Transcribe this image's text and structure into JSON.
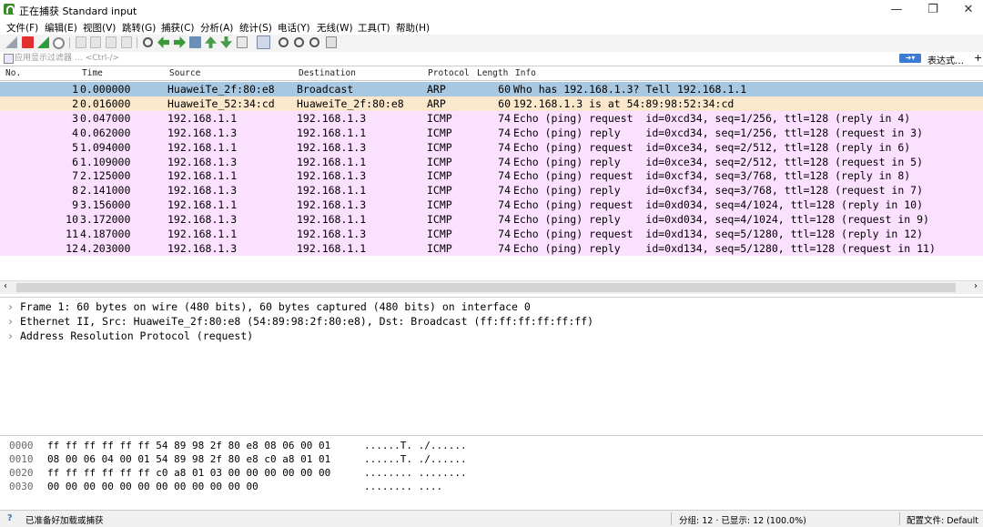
{
  "window": {
    "title": "正在捕获 Standard input",
    "minimize": "—",
    "maximize": "❐",
    "close": "✕"
  },
  "menu": [
    "文件(F)",
    "编辑(E)",
    "视图(V)",
    "跳转(G)",
    "捕获(C)",
    "分析(A)",
    "统计(S)",
    "电话(Y)",
    "无线(W)",
    "工具(T)",
    "帮助(H)"
  ],
  "toolbar_icons": [
    "shark-fin-start-icon",
    "stop-capture-icon",
    "restart-capture-icon",
    "capture-options-icon",
    "open-file-icon",
    "save-file-icon",
    "close-file-icon",
    "reload-file-icon",
    "find-packet-icon",
    "go-back-icon",
    "go-forward-icon",
    "go-to-packet-icon",
    "go-first-icon",
    "go-last-icon",
    "auto-scroll-icon",
    "colorize-icon",
    "zoom-in-icon",
    "zoom-out-icon",
    "zoom-normal-icon",
    "resize-columns-icon"
  ],
  "filter": {
    "placeholder": "应用显示过滤器 … <Ctrl-/>",
    "expression_label": "表达式…",
    "add_label": "+"
  },
  "columns": {
    "no": "No.",
    "time": "Time",
    "source": "Source",
    "destination": "Destination",
    "protocol": "Protocol",
    "length": "Length",
    "info": "Info"
  },
  "packets": [
    {
      "no": "1",
      "time": "0.000000",
      "source": "HuaweiTe_2f:80:e8",
      "destination": "Broadcast",
      "protocol": "ARP",
      "length": "60",
      "info": "Who has 192.168.1.3? Tell 192.168.1.1",
      "bg": "#a8c8e2"
    },
    {
      "no": "2",
      "time": "0.016000",
      "source": "HuaweiTe_52:34:cd",
      "destination": "HuaweiTe_2f:80:e8",
      "protocol": "ARP",
      "length": "60",
      "info": "192.168.1.3 is at 54:89:98:52:34:cd",
      "bg": "#fbe8cc"
    },
    {
      "no": "3",
      "time": "0.047000",
      "source": "192.168.1.1",
      "destination": "192.168.1.3",
      "protocol": "ICMP",
      "length": "74",
      "info": "Echo (ping) request  id=0xcd34, seq=1/256, ttl=128 (reply in 4)",
      "bg": "#fce0ff"
    },
    {
      "no": "4",
      "time": "0.062000",
      "source": "192.168.1.3",
      "destination": "192.168.1.1",
      "protocol": "ICMP",
      "length": "74",
      "info": "Echo (ping) reply    id=0xcd34, seq=1/256, ttl=128 (request in 3)",
      "bg": "#fce0ff"
    },
    {
      "no": "5",
      "time": "1.094000",
      "source": "192.168.1.1",
      "destination": "192.168.1.3",
      "protocol": "ICMP",
      "length": "74",
      "info": "Echo (ping) request  id=0xce34, seq=2/512, ttl=128 (reply in 6)",
      "bg": "#fce0ff"
    },
    {
      "no": "6",
      "time": "1.109000",
      "source": "192.168.1.3",
      "destination": "192.168.1.1",
      "protocol": "ICMP",
      "length": "74",
      "info": "Echo (ping) reply    id=0xce34, seq=2/512, ttl=128 (request in 5)",
      "bg": "#fce0ff"
    },
    {
      "no": "7",
      "time": "2.125000",
      "source": "192.168.1.1",
      "destination": "192.168.1.3",
      "protocol": "ICMP",
      "length": "74",
      "info": "Echo (ping) request  id=0xcf34, seq=3/768, ttl=128 (reply in 8)",
      "bg": "#fce0ff"
    },
    {
      "no": "8",
      "time": "2.141000",
      "source": "192.168.1.3",
      "destination": "192.168.1.1",
      "protocol": "ICMP",
      "length": "74",
      "info": "Echo (ping) reply    id=0xcf34, seq=3/768, ttl=128 (request in 7)",
      "bg": "#fce0ff"
    },
    {
      "no": "9",
      "time": "3.156000",
      "source": "192.168.1.1",
      "destination": "192.168.1.3",
      "protocol": "ICMP",
      "length": "74",
      "info": "Echo (ping) request  id=0xd034, seq=4/1024, ttl=128 (reply in 10)",
      "bg": "#fce0ff"
    },
    {
      "no": "10",
      "time": "3.172000",
      "source": "192.168.1.3",
      "destination": "192.168.1.1",
      "protocol": "ICMP",
      "length": "74",
      "info": "Echo (ping) reply    id=0xd034, seq=4/1024, ttl=128 (request in 9)",
      "bg": "#fce0ff"
    },
    {
      "no": "11",
      "time": "4.187000",
      "source": "192.168.1.1",
      "destination": "192.168.1.3",
      "protocol": "ICMP",
      "length": "74",
      "info": "Echo (ping) request  id=0xd134, seq=5/1280, ttl=128 (reply in 12)",
      "bg": "#fce0ff"
    },
    {
      "no": "12",
      "time": "4.203000",
      "source": "192.168.1.3",
      "destination": "192.168.1.1",
      "protocol": "ICMP",
      "length": "74",
      "info": "Echo (ping) reply    id=0xd134, seq=5/1280, ttl=128 (request in 11)",
      "bg": "#fce0ff"
    }
  ],
  "details": [
    "Frame 1: 60 bytes on wire (480 bits), 60 bytes captured (480 bits) on interface 0",
    "Ethernet II, Src: HuaweiTe_2f:80:e8 (54:89:98:2f:80:e8), Dst: Broadcast (ff:ff:ff:ff:ff:ff)",
    "Address Resolution Protocol (request)"
  ],
  "bytes": [
    {
      "offset": "0000",
      "hex": "ff ff ff ff ff ff 54 89  98 2f 80 e8 08 06 00 01",
      "ascii": "......T. ./......"
    },
    {
      "offset": "0010",
      "hex": "08 00 06 04 00 01 54 89  98 2f 80 e8 c0 a8 01 01",
      "ascii": "......T. ./......"
    },
    {
      "offset": "0020",
      "hex": "ff ff ff ff ff ff c0 a8  01 03 00 00 00 00 00 00",
      "ascii": "........ ........"
    },
    {
      "offset": "0030",
      "hex": "00 00 00 00 00 00 00 00  00 00 00 00",
      "ascii": "........ ...."
    }
  ],
  "status": {
    "help_icon": "?",
    "message": "已准备好加载或捕获",
    "counts": "分组: 12 · 已显示: 12 (100.0%)",
    "profile": "配置文件: Default"
  }
}
